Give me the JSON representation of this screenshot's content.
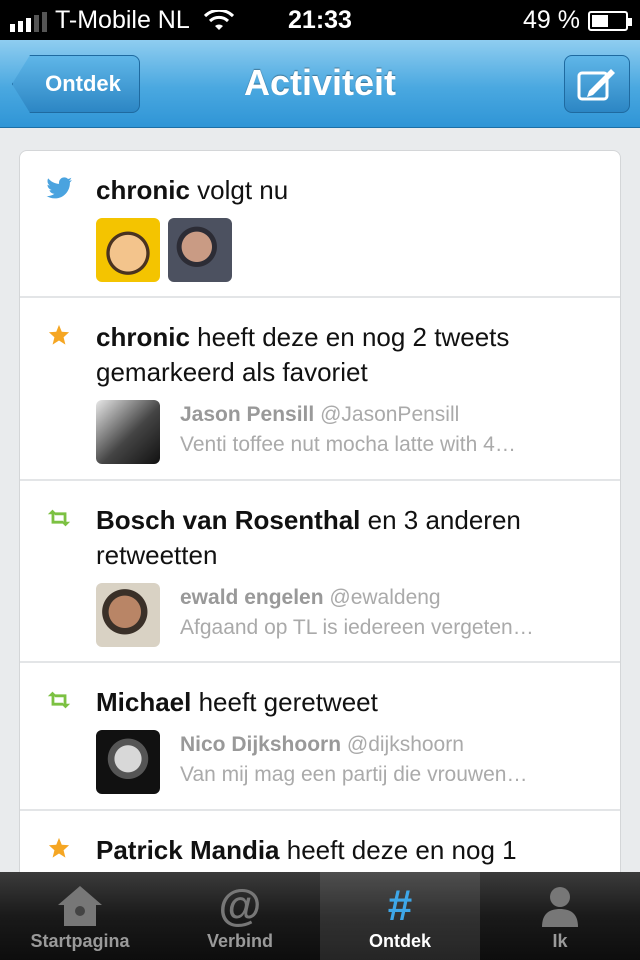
{
  "status_bar": {
    "carrier": "T-Mobile NL",
    "time": "21:33",
    "battery_percent": "49 %",
    "battery_level": 0.49,
    "signal_bars": 3
  },
  "nav": {
    "back_label": "Ontdek",
    "title": "Activiteit",
    "compose_icon": "compose-icon"
  },
  "activity": [
    {
      "type": "follow",
      "icon": "twitter-bird-icon",
      "actor": "chronic",
      "text": " volgt nu"
    },
    {
      "type": "favorite",
      "icon": "star-icon",
      "actor": "chronic",
      "text": " heeft deze en nog 2 tweets gemarkeerd als favoriet",
      "tweet": {
        "name": "Jason Pensill",
        "handle": "@JasonPensill",
        "text": "Venti toffee nut mocha latte with 4…"
      }
    },
    {
      "type": "retweet",
      "icon": "retweet-icon",
      "actor": "Bosch van Rosenthal",
      "text": " en 3 anderen retweetten",
      "tweet": {
        "name": "ewald engelen",
        "handle": "@ewaldeng",
        "text": "Afgaand op TL is iedereen vergeten…"
      }
    },
    {
      "type": "retweet",
      "icon": "retweet-icon",
      "actor": "Michael",
      "text": " heeft geretweet",
      "tweet": {
        "name": "Nico Dijkshoorn",
        "handle": "@dijkshoorn",
        "text": "Van mij mag een partij die vrouwen…"
      }
    },
    {
      "type": "favorite",
      "icon": "star-icon",
      "actor": "Patrick Mandia",
      "text": " heeft deze en nog 1"
    }
  ],
  "tabs": [
    {
      "label": "Startpagina",
      "icon": "home-icon",
      "active": false
    },
    {
      "label": "Verbind",
      "icon": "at-icon",
      "active": false
    },
    {
      "label": "Ontdek",
      "icon": "hashtag-icon",
      "active": true
    },
    {
      "label": "Ik",
      "icon": "person-icon",
      "active": false
    }
  ],
  "colors": {
    "nav_blue": "#4aa8e0",
    "star": "#f5a623",
    "retweet": "#7cc142",
    "bird": "#4aa3df",
    "active_tab": "#3ea7e8"
  }
}
